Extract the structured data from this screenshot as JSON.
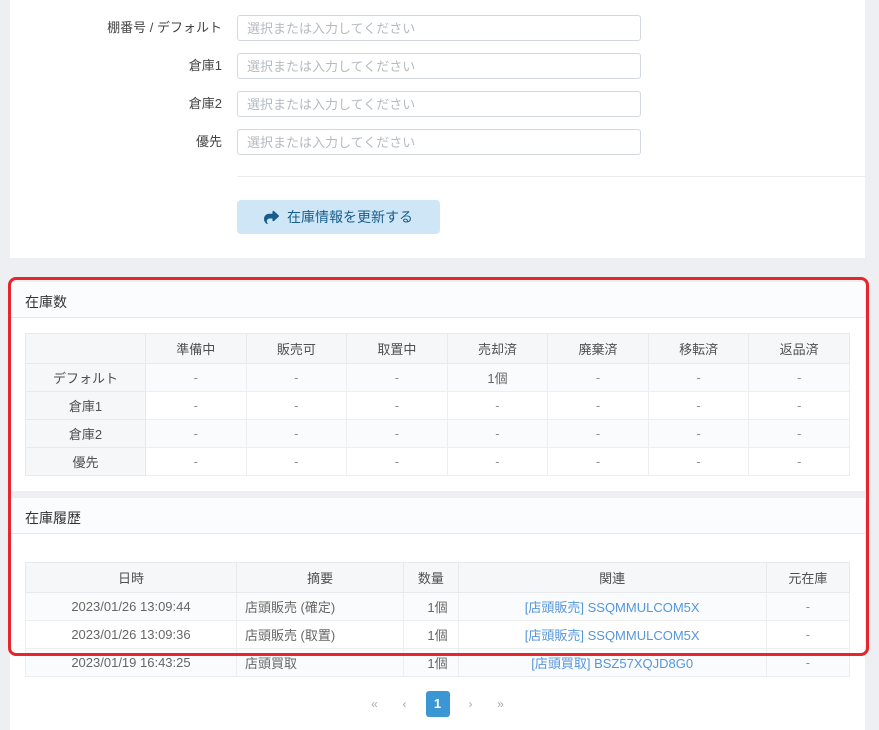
{
  "form": {
    "fields": [
      {
        "label": "棚番号 / デフォルト",
        "placeholder": "選択または入力してください"
      },
      {
        "label": "倉庫1",
        "placeholder": "選択または入力してください"
      },
      {
        "label": "倉庫2",
        "placeholder": "選択または入力してください"
      },
      {
        "label": "優先",
        "placeholder": "選択または入力してください"
      }
    ],
    "submit_label": "在庫情報を更新する"
  },
  "stock_panel": {
    "title": "在庫数",
    "columns": [
      "準備中",
      "販売可",
      "取置中",
      "売却済",
      "廃棄済",
      "移転済",
      "返品済"
    ],
    "rows": [
      {
        "label": "デフォルト",
        "values": [
          "-",
          "-",
          "-",
          "1個",
          "-",
          "-",
          "-"
        ]
      },
      {
        "label": "倉庫1",
        "values": [
          "-",
          "-",
          "-",
          "-",
          "-",
          "-",
          "-"
        ]
      },
      {
        "label": "倉庫2",
        "values": [
          "-",
          "-",
          "-",
          "-",
          "-",
          "-",
          "-"
        ]
      },
      {
        "label": "優先",
        "values": [
          "-",
          "-",
          "-",
          "-",
          "-",
          "-",
          "-"
        ]
      }
    ]
  },
  "history_panel": {
    "title": "在庫履歴",
    "columns": [
      "日時",
      "摘要",
      "数量",
      "関連",
      "元在庫"
    ],
    "rows": [
      {
        "datetime": "2023/01/26 13:09:44",
        "summary": "店頭販売 (確定)",
        "quantity": "1個",
        "related": "[店頭販売] SSQMMULCOM5X",
        "original": "-"
      },
      {
        "datetime": "2023/01/26 13:09:36",
        "summary": "店頭販売 (取置)",
        "quantity": "1個",
        "related": "[店頭販売] SSQMMULCOM5X",
        "original": "-"
      },
      {
        "datetime": "2023/01/19 16:43:25",
        "summary": "店頭買取",
        "quantity": "1個",
        "related": "[店頭買取] BSZ57XQJD8G0",
        "original": "-"
      }
    ]
  },
  "pagination": {
    "first": "«",
    "prev": "‹",
    "current": "1",
    "next": "›",
    "last": "»"
  },
  "colors": {
    "button_bg": "#cfe6f7",
    "button_text": "#175d8e",
    "link": "#5596db",
    "pagination_active_bg": "#3b97d3",
    "annotation_red": "#e6262c",
    "page_bg": "#edeff2"
  }
}
